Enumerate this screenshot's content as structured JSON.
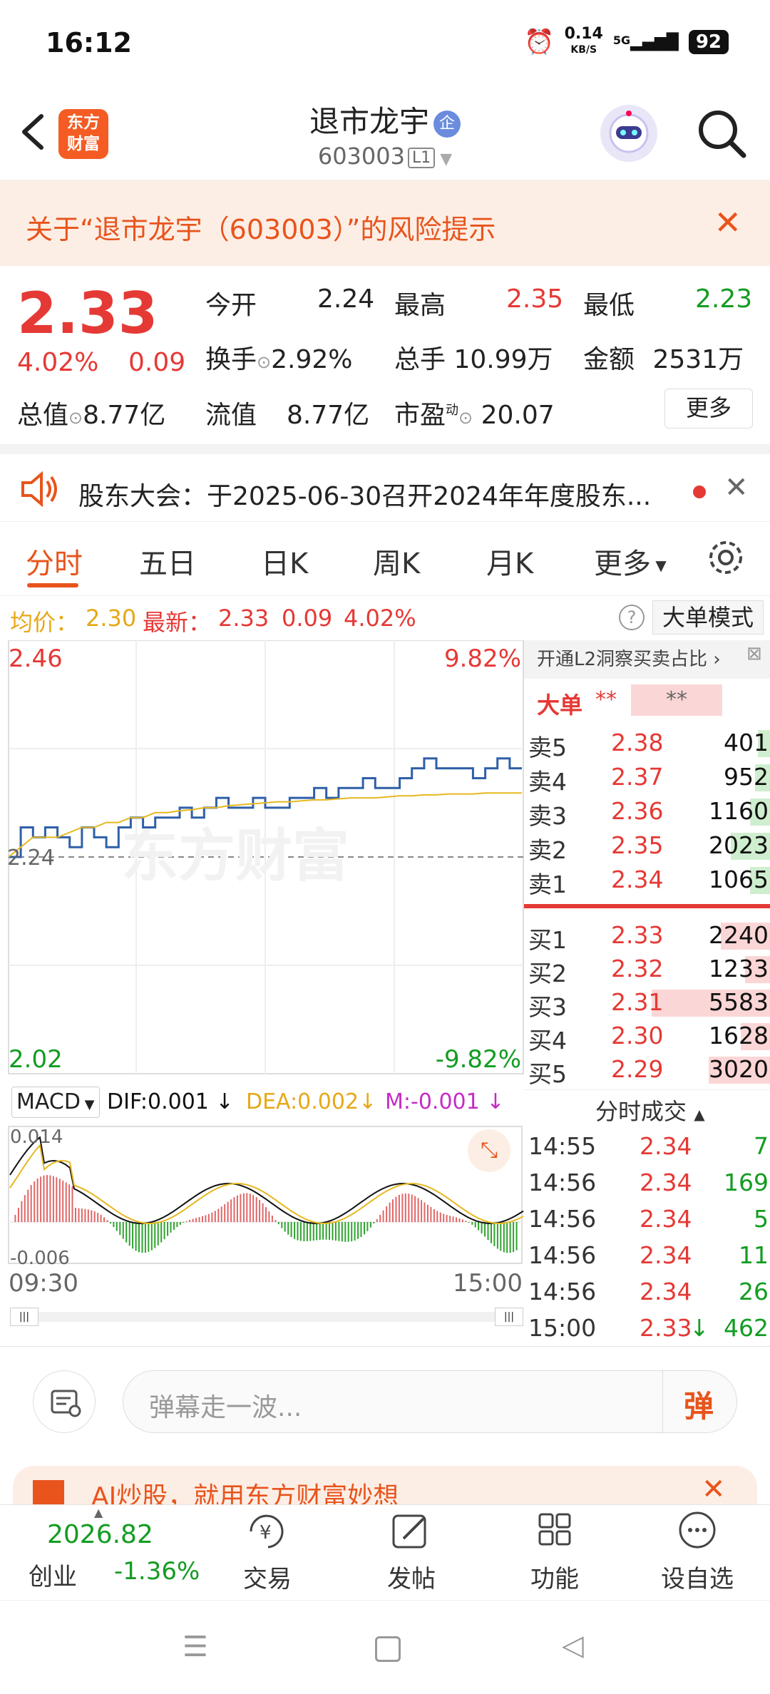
{
  "status": {
    "time": "16:12",
    "speed": "0.14",
    "speed_unit": "KB/S",
    "network": "5G",
    "battery": "92"
  },
  "header": {
    "logo_line1": "东方",
    "logo_line2": "财富",
    "title": "退市龙宇",
    "badge": "企",
    "code": "603003",
    "level": "L1"
  },
  "risk": {
    "text": "关于“退市龙宇（603003）”的风险提示",
    "close": "✕"
  },
  "quote": {
    "price": "2.33",
    "change_pct": "4.02%",
    "change": "0.09",
    "open_label": "今开",
    "open": "2.24",
    "high_label": "最高",
    "high": "2.35",
    "low_label": "最低",
    "low": "2.23",
    "turnover_label": "换手",
    "turnover": "2.92%",
    "volume_label": "总手",
    "volume": "10.99万",
    "amount_label": "金额",
    "amount": "2531万",
    "mktcap_label": "总值",
    "mktcap": "8.77亿",
    "float_label": "流值",
    "float": "8.77亿",
    "pe_label": "市盈",
    "pe_sup": "动",
    "pe": "20.07",
    "more": "更多"
  },
  "notice": {
    "text": "股东大会：于2025-06-30召开2024年年度股东...",
    "close": "✕"
  },
  "tabs": [
    "分时",
    "五日",
    "日K",
    "周K",
    "月K",
    "更多"
  ],
  "infobar": {
    "avg_label": "均价：",
    "avg": "2.30",
    "latest_label": "最新：",
    "latest": "2.33",
    "change": "0.09",
    "pct": "4.02%",
    "mode": "大单模式",
    "help": "?"
  },
  "chart": {
    "ymax": "2.46",
    "ymax_pct": "9.82%",
    "ymin": "2.02",
    "ymin_pct": "-9.82%",
    "mid": "2.24",
    "watermark": "东方财富"
  },
  "chart_data": {
    "type": "line",
    "ylim": [
      2.02,
      2.46
    ],
    "series": [
      {
        "values": [
          2.24,
          2.27,
          2.26,
          2.27,
          2.26,
          2.25,
          2.27,
          2.26,
          2.25,
          2.27,
          2.28,
          2.27,
          2.28,
          2.28,
          2.29,
          2.28,
          2.29,
          2.3,
          2.29,
          2.29,
          2.3,
          2.29,
          2.29,
          2.3,
          2.3,
          2.31,
          2.3,
          2.31,
          2.31,
          2.32,
          2.31,
          2.31,
          2.32,
          2.33,
          2.34,
          2.33,
          2.33,
          2.33,
          2.32,
          2.33,
          2.34,
          2.33,
          2.33
        ]
      },
      {
        "values": [
          2.24,
          2.25,
          2.26,
          2.26,
          2.26,
          2.265,
          2.27,
          2.27,
          2.275,
          2.275,
          2.28,
          2.28,
          2.285,
          2.285,
          2.287,
          2.288,
          2.29,
          2.29,
          2.292,
          2.293,
          2.294,
          2.295,
          2.296,
          2.296,
          2.297,
          2.298,
          2.298,
          2.299,
          2.3,
          2.3,
          2.3,
          2.301,
          2.302,
          2.302,
          2.303,
          2.303,
          2.304,
          2.304,
          2.304,
          2.305,
          2.305,
          2.305,
          2.305
        ]
      }
    ]
  },
  "macd": {
    "label": "MACD",
    "dif": "DIF:0.001",
    "dea": "DEA:0.002",
    "m": "M:-0.001",
    "ytop": "0.014",
    "ybot": "-0.006",
    "tstart": "09:30",
    "tend": "15:00"
  },
  "orderbook": {
    "l2": "开通L2洞察买卖占比",
    "big_label": "大单",
    "big_star1": "**",
    "big_star2": "**",
    "sells": [
      {
        "label": "卖5",
        "price": "2.38",
        "vol": "401",
        "bar": 0.05
      },
      {
        "label": "卖4",
        "price": "2.37",
        "vol": "952",
        "bar": 0.06
      },
      {
        "label": "卖3",
        "price": "2.36",
        "vol": "1160",
        "bar": 0.08
      },
      {
        "label": "卖2",
        "price": "2.35",
        "vol": "2023",
        "bar": 0.16
      },
      {
        "label": "卖1",
        "price": "2.34",
        "vol": "1065",
        "bar": 0.08
      }
    ],
    "buys": [
      {
        "label": "买1",
        "price": "2.33",
        "vol": "2240",
        "bar": 0.2
      },
      {
        "label": "买2",
        "price": "2.32",
        "vol": "1233",
        "bar": 0.1
      },
      {
        "label": "买3",
        "price": "2.31",
        "vol": "5583",
        "bar": 0.48
      },
      {
        "label": "买4",
        "price": "2.30",
        "vol": "1628",
        "bar": 0.12
      },
      {
        "label": "买5",
        "price": "2.29",
        "vol": "3020",
        "bar": 0.25
      }
    ],
    "trades_title": "分时成交",
    "trades": [
      {
        "time": "14:55",
        "price": "2.34",
        "vol": "7",
        "arrow": ""
      },
      {
        "time": "14:56",
        "price": "2.34",
        "vol": "169",
        "arrow": ""
      },
      {
        "time": "14:56",
        "price": "2.34",
        "vol": "5",
        "arrow": ""
      },
      {
        "time": "14:56",
        "price": "2.34",
        "vol": "11",
        "arrow": ""
      },
      {
        "time": "14:56",
        "price": "2.34",
        "vol": "26",
        "arrow": ""
      },
      {
        "time": "15:00",
        "price": "2.33",
        "vol": "462",
        "arrow": "↓"
      }
    ]
  },
  "danmu": {
    "placeholder": "弹幕走一波...",
    "btn": "弹"
  },
  "ad": {
    "text": "AI炒股，就用东方财富妙想"
  },
  "bottomnav": {
    "index_value": "2026.82",
    "index_name": "创业",
    "index_pct": "-1.36%",
    "items": [
      "交易",
      "发帖",
      "功能",
      "设自选"
    ]
  }
}
